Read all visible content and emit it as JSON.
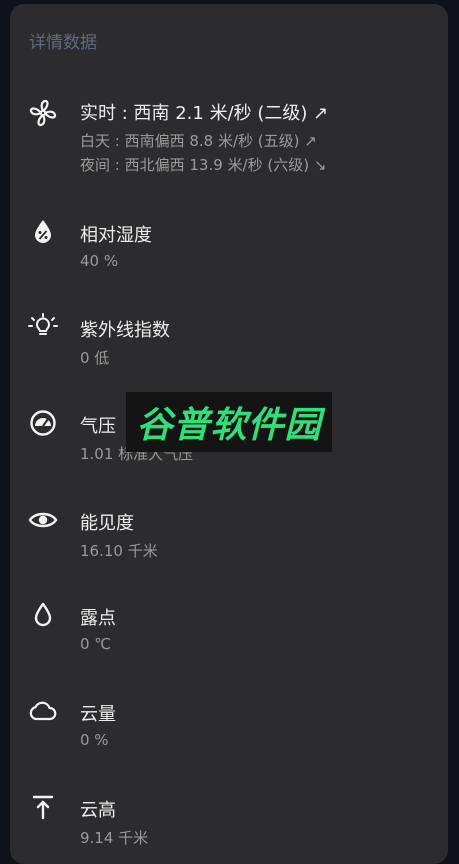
{
  "header": {
    "title": "详情数据"
  },
  "items": [
    {
      "icon": "fan-icon",
      "title": "实时 : 西南 2.1 米/秒 (二级) ↗",
      "subs": [
        "白天 : 西南偏西 8.8 米/秒 (五级) ↗",
        "夜间 : 西北偏西 13.9 米/秒 (六级) ↘"
      ]
    },
    {
      "icon": "humidity-icon",
      "title": "相对湿度",
      "subs": [
        "40 %"
      ]
    },
    {
      "icon": "uv-bulb-icon",
      "title": "紫外线指数",
      "subs": [
        "0 低"
      ]
    },
    {
      "icon": "gauge-icon",
      "title": "气压",
      "subs": [
        "1.01 标准大气压"
      ]
    },
    {
      "icon": "eye-icon",
      "title": "能见度",
      "subs": [
        "16.10 千米"
      ]
    },
    {
      "icon": "drop-icon",
      "title": "露点",
      "subs": [
        "0 ℃"
      ]
    },
    {
      "icon": "cloud-icon",
      "title": "云量",
      "subs": [
        "0 %"
      ]
    },
    {
      "icon": "ceiling-icon",
      "title": "云高",
      "subs": [
        "9.14 千米"
      ]
    }
  ],
  "watermark": {
    "text": "谷普软件园"
  },
  "colors": {
    "card": "#2c2c2e",
    "section_title": "#5f6b80",
    "title": "#ececec",
    "sub": "#9a9a9a",
    "watermark_text": "#2fe07a"
  }
}
